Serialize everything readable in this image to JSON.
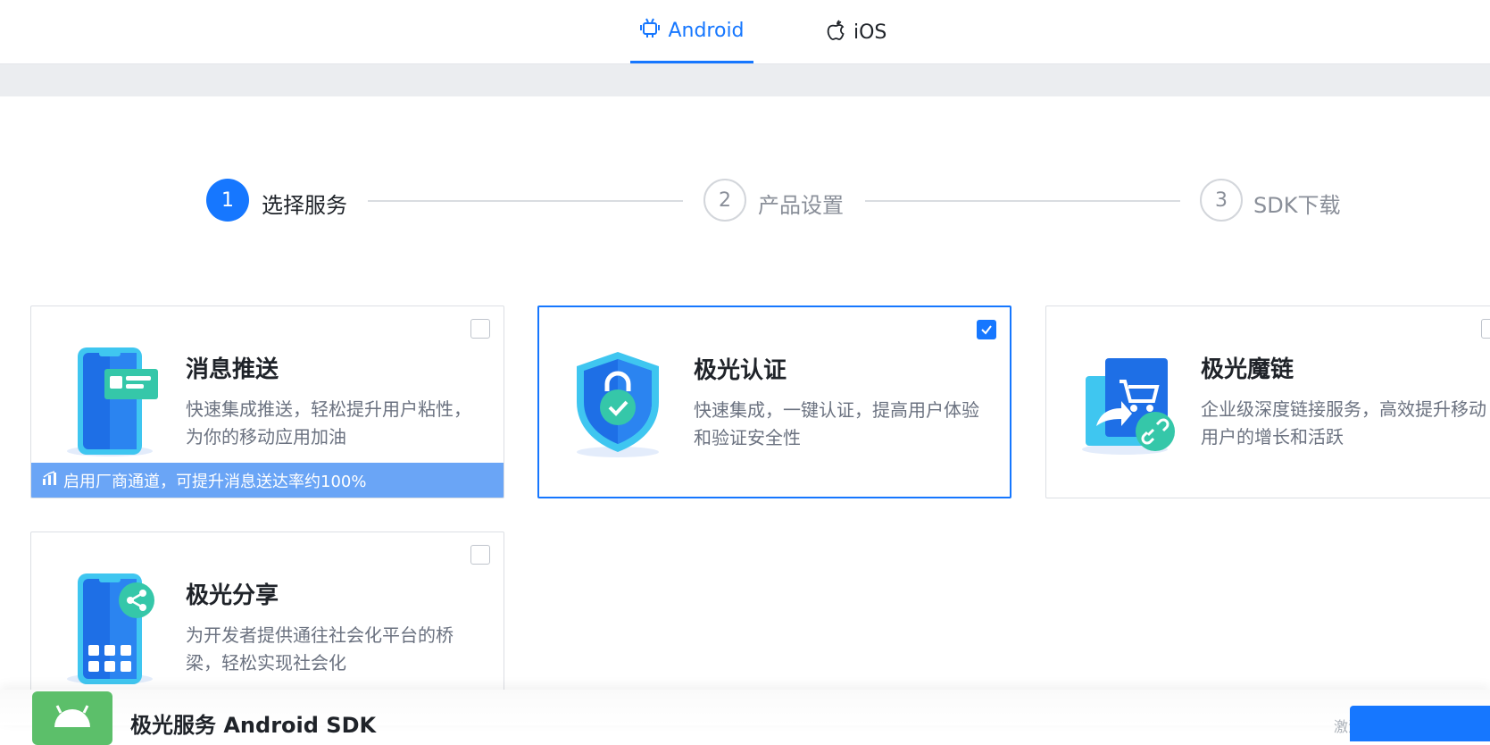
{
  "tabs": [
    {
      "label": "Android",
      "icon": "android-icon",
      "active": true
    },
    {
      "label": "iOS",
      "icon": "apple-icon",
      "active": false
    }
  ],
  "steps": [
    {
      "number": "1",
      "label": "选择服务",
      "active": true
    },
    {
      "number": "2",
      "label": "产品设置",
      "active": false
    },
    {
      "number": "3",
      "label": "SDK下载",
      "active": false
    }
  ],
  "services": [
    {
      "title": "消息推送",
      "description": "快速集成推送，轻松提升用户粘性，为你的移动应用加油",
      "checked": false,
      "banner": "启用厂商通道，可提升消息送达率约100%",
      "icon": "phone-push-icon"
    },
    {
      "title": "极光认证",
      "description": "快速集成，一键认证，提高用户体验和验证安全性",
      "checked": true,
      "icon": "shield-lock-icon"
    },
    {
      "title": "极光魔链",
      "description": "企业级深度链接服务，高效提升移动用户的增长和活跃",
      "checked": false,
      "icon": "cart-link-icon"
    },
    {
      "title": "极光分享",
      "description": "为开发者提供通往社会化平台的桥梁，轻松实现社会化",
      "checked": false,
      "icon": "phone-share-icon"
    }
  ],
  "footer": {
    "title": "极光服务 Android SDK",
    "watermark": "激活 Wi",
    "icon": "android-robot-icon"
  },
  "colors": {
    "accent": "#1677ff",
    "banner": "#6aa5f6",
    "teal": "#2ecc9f"
  }
}
